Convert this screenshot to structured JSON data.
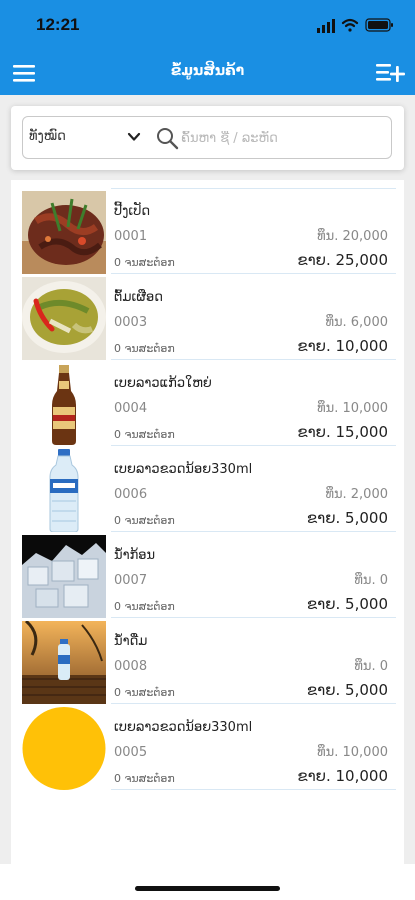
{
  "status_bar": {
    "time": "12:21"
  },
  "header": {
    "title": "ຂໍ້ມູນສິນຄ້າ"
  },
  "filter": {
    "category": "ທັງໝົດ",
    "search_placeholder": "ຄົ້ນຫາ ຊື່ / ລະຫັດ"
  },
  "products": [
    {
      "name": "ປີ້ງເປັດ",
      "code": "0001",
      "cost": "ທຶນ. 20,000",
      "stock": "0 ຈນສະຕ໋ອກ",
      "price": "ຂາຍ. 25,000",
      "image": "food-photo"
    },
    {
      "name": "ຕົ້ມເຜືອດ",
      "code": "0003",
      "cost": "ທຶນ. 6,000",
      "stock": "0 ຈນສະຕ໋ອກ",
      "price": "ຂາຍ. 10,000",
      "image": "soup-photo"
    },
    {
      "name": "ເບຍລາວແກ້ວໃຫຍ່",
      "code": "0004",
      "cost": "ທຶນ. 10,000",
      "stock": "0 ຈນສະຕ໋ອກ",
      "price": "ຂາຍ. 15,000",
      "image": "beer-bottle-photo"
    },
    {
      "name": "ເບຍລາວຂວດນ້ອຍ330ml",
      "code": "0006",
      "cost": "ທຶນ. 2,000",
      "stock": "0 ຈນສະຕ໋ອກ",
      "price": "ຂາຍ. 5,000",
      "image": "water-bottle-photo"
    },
    {
      "name": "ນ້ຳກ້ອນ",
      "code": "0007",
      "cost": "ທຶນ. 0",
      "stock": "0 ຈນສະຕ໋ອກ",
      "price": "ຂາຍ. 5,000",
      "image": "ice-photo"
    },
    {
      "name": "ນ້ຳດື່ມ",
      "code": "0008",
      "cost": "ທຶນ. 0",
      "stock": "0 ຈນສະຕ໋ອກ",
      "price": "ຂາຍ. 5,000",
      "image": "water-sunset-photo"
    },
    {
      "name": "ເບຍລາວຂວດນ້ອຍ330ml",
      "code": "0005",
      "cost": "ທຶນ. 10,000",
      "stock": "0 ຈນສະຕ໋ອກ",
      "price": "ຂາຍ. 10,000",
      "image": "yellow-circle-placeholder"
    }
  ],
  "colors": {
    "header": "#1a8fe3",
    "placeholder_circle": "#ffc107"
  }
}
